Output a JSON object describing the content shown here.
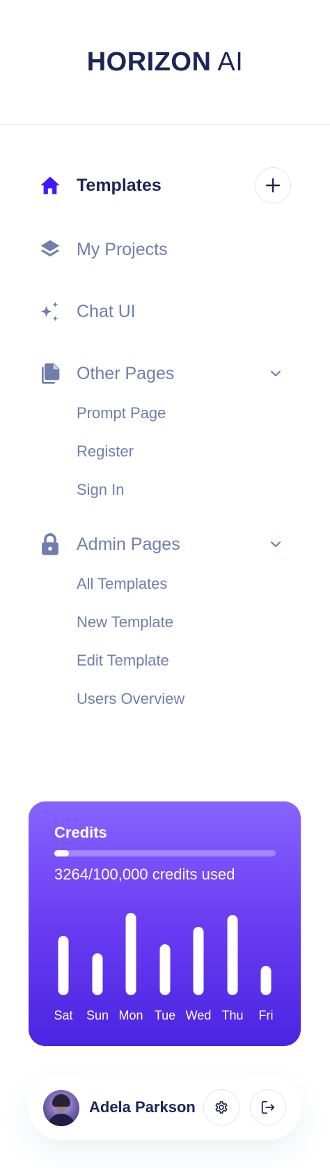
{
  "brand": {
    "name_bold": "HORIZON",
    "name_light": "AI"
  },
  "nav": {
    "templates": {
      "label": "Templates",
      "icon": "home-icon"
    },
    "my_projects": {
      "label": "My Projects",
      "icon": "layers-icon"
    },
    "chat_ui": {
      "label": "Chat UI",
      "icon": "sparkles-icon"
    },
    "other_pages": {
      "label": "Other Pages",
      "icon": "documents-icon",
      "children": [
        "Prompt Page",
        "Register",
        "Sign In"
      ]
    },
    "admin_pages": {
      "label": "Admin Pages",
      "icon": "lock-icon",
      "children": [
        "All Templates",
        "New Template",
        "Edit Template",
        "Users Overview"
      ]
    }
  },
  "credits": {
    "title": "Credits",
    "used_text": "3264/100,000 credits used",
    "progress_fraction": 0.0326
  },
  "chart_data": {
    "type": "bar",
    "categories": [
      "Sat",
      "Sun",
      "Mon",
      "Tue",
      "Wed",
      "Thu",
      "Fri"
    ],
    "values": [
      85,
      60,
      118,
      73,
      98,
      115,
      42
    ]
  },
  "profile": {
    "name": "Adela Parkson"
  },
  "colors": {
    "accent": "#4318ff",
    "text_primary": "#1b2559",
    "text_secondary": "#707eae",
    "card_gradient_top": "#8764ff",
    "card_gradient_bottom": "#4a25e1"
  }
}
